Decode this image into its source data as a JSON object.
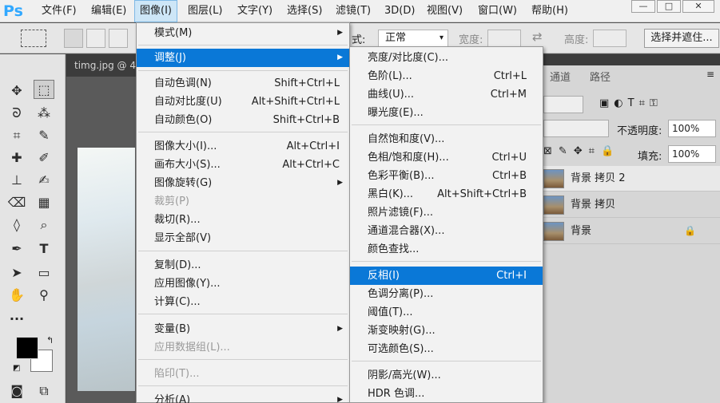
{
  "menubar": {
    "logo": "Ps",
    "items": [
      "文件(F)",
      "编辑(E)",
      "图像(I)",
      "图层(L)",
      "文字(Y)",
      "选择(S)",
      "滤镜(T)",
      "3D(D)",
      "视图(V)",
      "窗口(W)",
      "帮助(H)"
    ],
    "active_index": 2,
    "window_buttons": [
      "—",
      "□",
      "✕"
    ]
  },
  "options": {
    "style_label": "式:",
    "style_value": "正常",
    "width_label": "宽度:",
    "height_label": "高度:",
    "select_mask_button": "选择并遮住..."
  },
  "document": {
    "tab_title": "timg.jpg @ 4"
  },
  "image_menu": {
    "items": [
      {
        "label": "模式(M)",
        "shortcut": "",
        "submenu": true,
        "disabled": false
      },
      {
        "label": "调整(J)",
        "shortcut": "",
        "submenu": true,
        "disabled": false,
        "highlighted": true
      },
      {
        "label": "自动色调(N)",
        "shortcut": "Shift+Ctrl+L",
        "submenu": false,
        "disabled": false
      },
      {
        "label": "自动对比度(U)",
        "shortcut": "Alt+Shift+Ctrl+L",
        "submenu": false,
        "disabled": false
      },
      {
        "label": "自动颜色(O)",
        "shortcut": "Shift+Ctrl+B",
        "submenu": false,
        "disabled": false
      },
      {
        "label": "图像大小(I)...",
        "shortcut": "Alt+Ctrl+I",
        "submenu": false,
        "disabled": false
      },
      {
        "label": "画布大小(S)...",
        "shortcut": "Alt+Ctrl+C",
        "submenu": false,
        "disabled": false
      },
      {
        "label": "图像旋转(G)",
        "shortcut": "",
        "submenu": true,
        "disabled": false
      },
      {
        "label": "裁剪(P)",
        "shortcut": "",
        "submenu": false,
        "disabled": true
      },
      {
        "label": "裁切(R)...",
        "shortcut": "",
        "submenu": false,
        "disabled": false
      },
      {
        "label": "显示全部(V)",
        "shortcut": "",
        "submenu": false,
        "disabled": false
      },
      {
        "label": "复制(D)...",
        "shortcut": "",
        "submenu": false,
        "disabled": false
      },
      {
        "label": "应用图像(Y)...",
        "shortcut": "",
        "submenu": false,
        "disabled": false
      },
      {
        "label": "计算(C)...",
        "shortcut": "",
        "submenu": false,
        "disabled": false
      },
      {
        "label": "变量(B)",
        "shortcut": "",
        "submenu": true,
        "disabled": false
      },
      {
        "label": "应用数据组(L)...",
        "shortcut": "",
        "submenu": false,
        "disabled": true
      },
      {
        "label": "陷印(T)...",
        "shortcut": "",
        "submenu": false,
        "disabled": true
      },
      {
        "label": "分析(A)",
        "shortcut": "",
        "submenu": true,
        "disabled": false
      }
    ]
  },
  "adjust_menu": {
    "items": [
      {
        "label": "亮度/对比度(C)...",
        "shortcut": ""
      },
      {
        "label": "色阶(L)...",
        "shortcut": "Ctrl+L"
      },
      {
        "label": "曲线(U)...",
        "shortcut": "Ctrl+M"
      },
      {
        "label": "曝光度(E)...",
        "shortcut": ""
      },
      {
        "label": "自然饱和度(V)...",
        "shortcut": ""
      },
      {
        "label": "色相/饱和度(H)...",
        "shortcut": "Ctrl+U"
      },
      {
        "label": "色彩平衡(B)...",
        "shortcut": "Ctrl+B"
      },
      {
        "label": "黑白(K)...",
        "shortcut": "Alt+Shift+Ctrl+B"
      },
      {
        "label": "照片滤镜(F)...",
        "shortcut": ""
      },
      {
        "label": "通道混合器(X)...",
        "shortcut": ""
      },
      {
        "label": "颜色查找...",
        "shortcut": ""
      },
      {
        "label": "反相(I)",
        "shortcut": "Ctrl+I",
        "highlighted": true
      },
      {
        "label": "色调分离(P)...",
        "shortcut": ""
      },
      {
        "label": "阈值(T)...",
        "shortcut": ""
      },
      {
        "label": "渐变映射(G)...",
        "shortcut": ""
      },
      {
        "label": "可选颜色(S)...",
        "shortcut": ""
      },
      {
        "label": "阴影/高光(W)...",
        "shortcut": ""
      },
      {
        "label": "HDR 色调...",
        "shortcut": ""
      }
    ]
  },
  "layers_panel": {
    "tabs": [
      "通道",
      "路径"
    ],
    "opacity_label": "不透明度:",
    "opacity_value": "100%",
    "fill_label": "填充:",
    "fill_value": "100%",
    "layers": [
      {
        "name": "背景 拷贝 2",
        "selected": true,
        "locked": false
      },
      {
        "name": "背景 拷贝",
        "selected": false,
        "locked": false
      },
      {
        "name": "背景",
        "selected": false,
        "locked": true
      }
    ]
  },
  "colors": {
    "accent": "#0a78d7",
    "ps_blue": "#31a8ff"
  }
}
